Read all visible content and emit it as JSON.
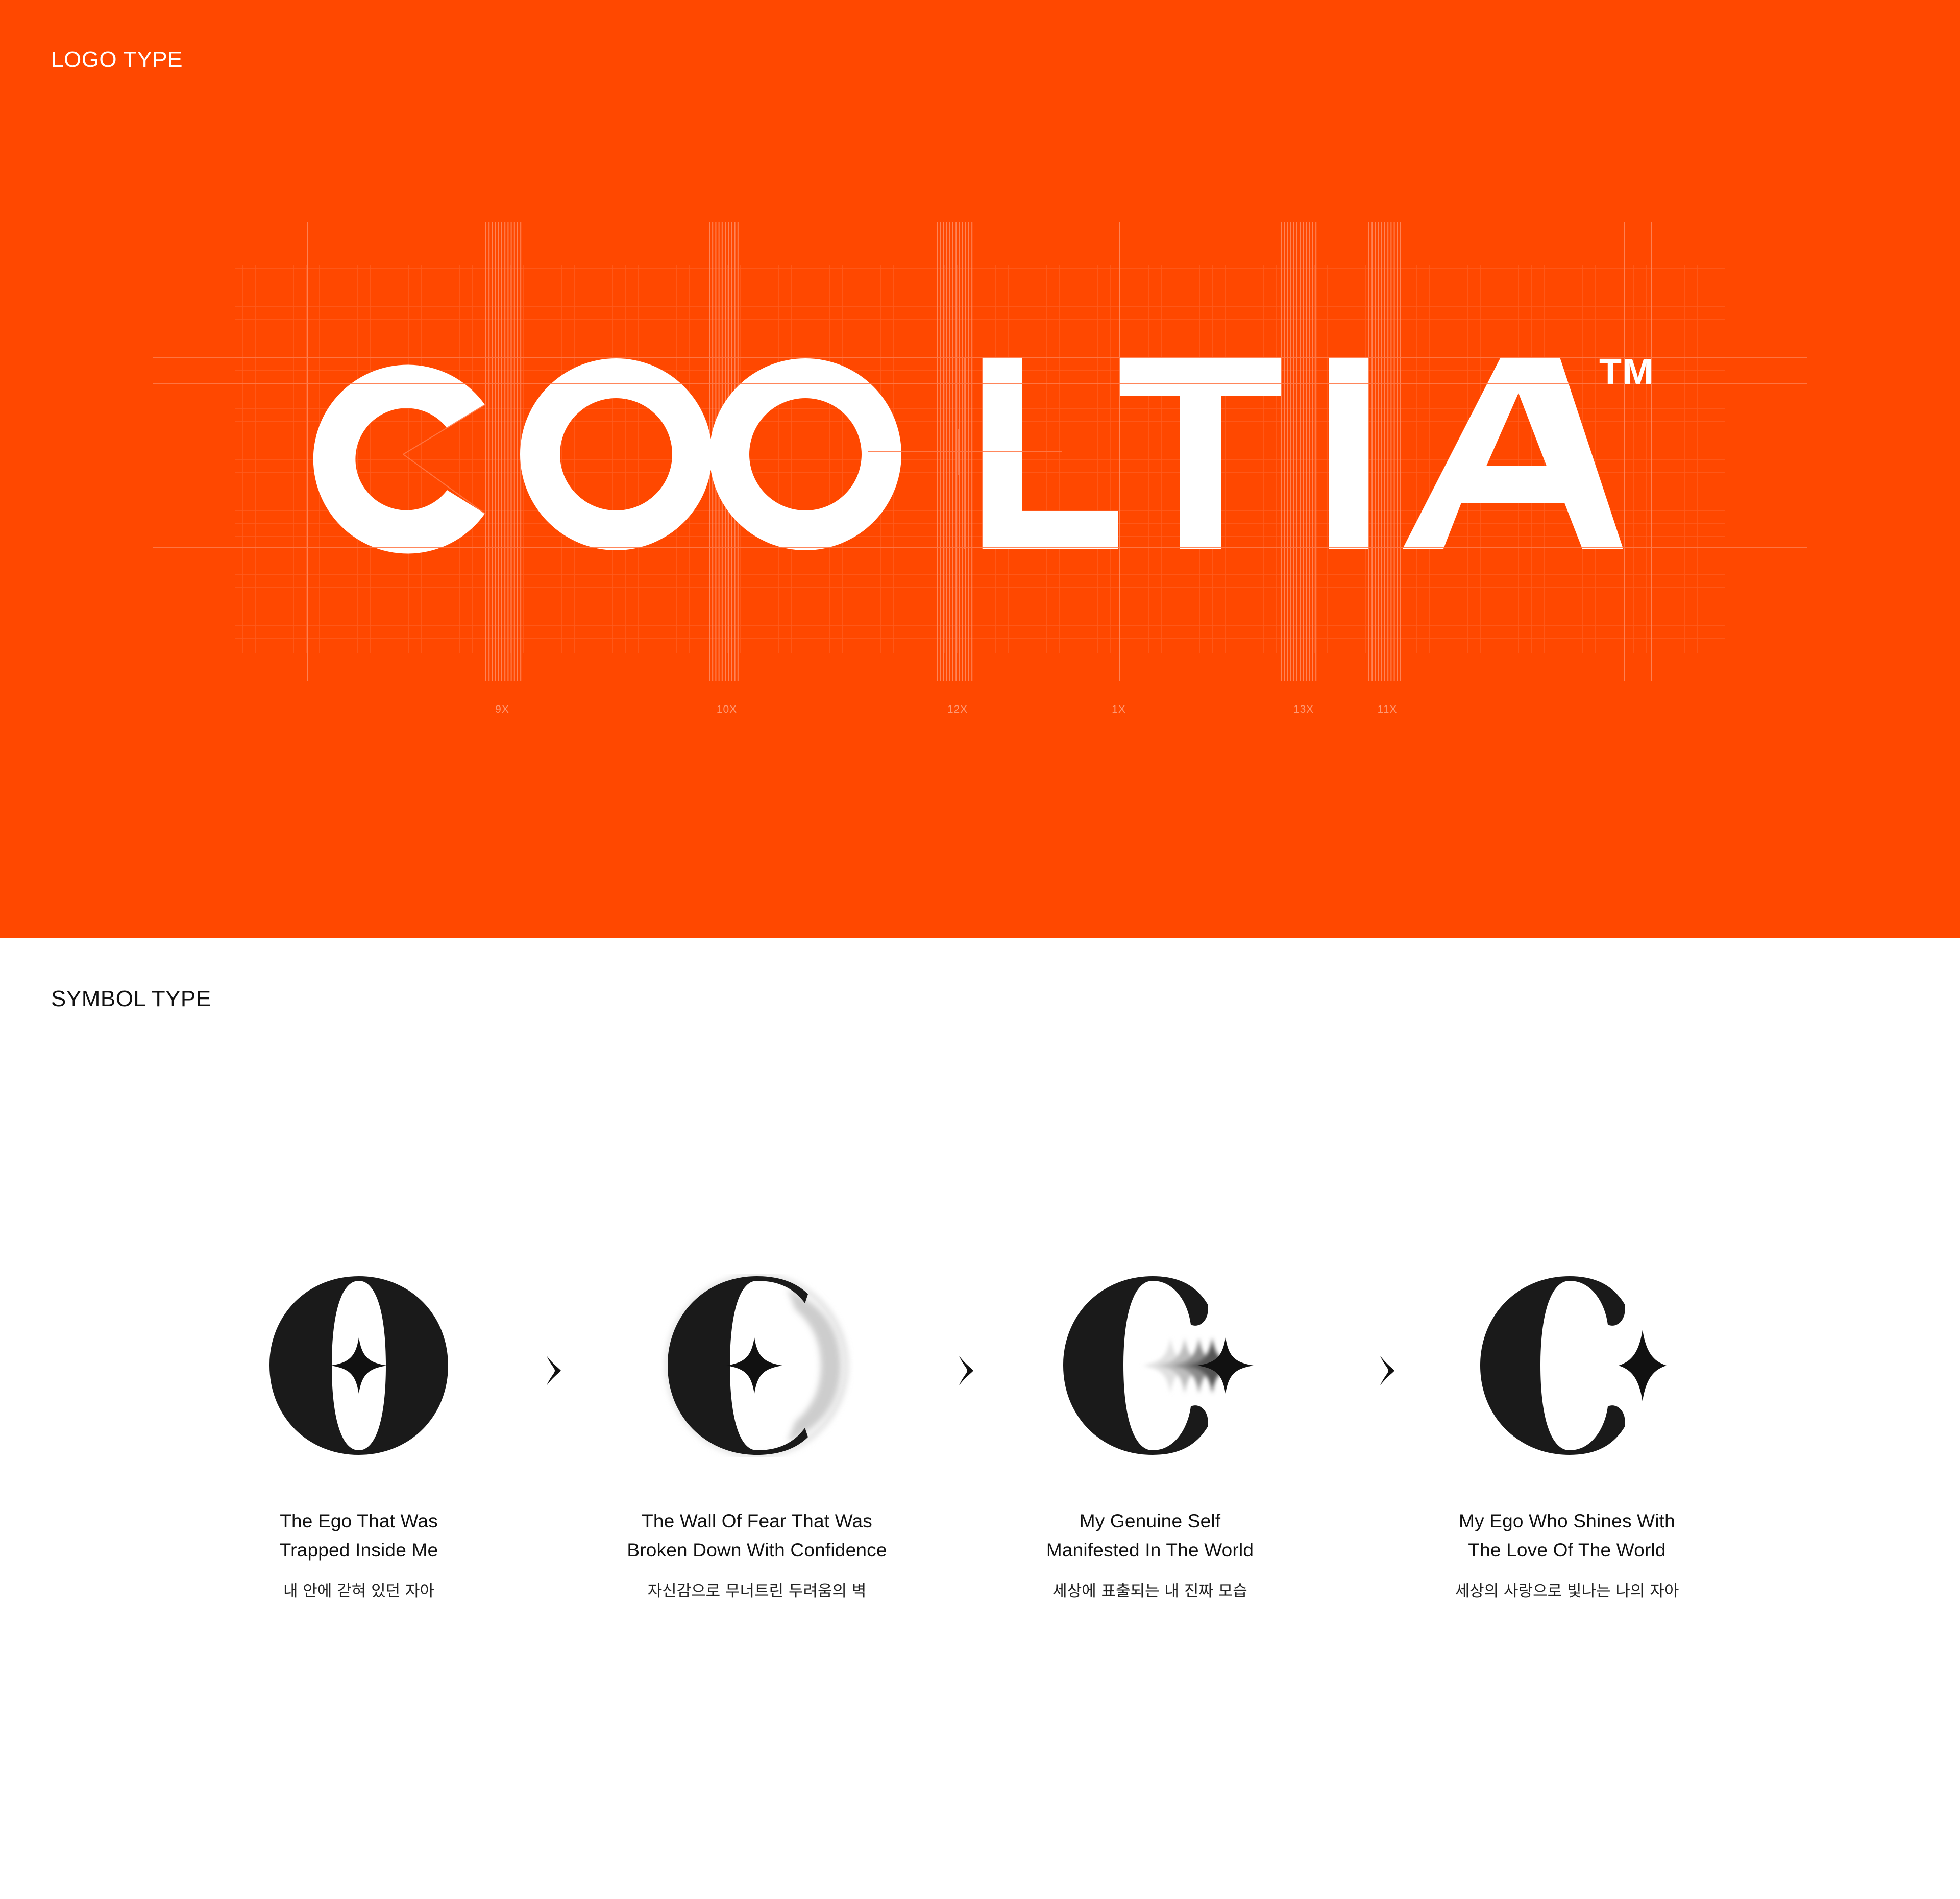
{
  "colors": {
    "brand": "#FF4800",
    "white": "#FFFFFF",
    "ink": "#1A1A1A",
    "grid_line": "#FF7A4A"
  },
  "logo_section": {
    "title": "LOGO TYPE",
    "wordmark": "COOLTIA",
    "trademark": "TM",
    "grid_labels": [
      "9X",
      "10X",
      "12X",
      "1X",
      "13X",
      "11X"
    ]
  },
  "symbol_section": {
    "title": "SYMBOL TYPE",
    "arrow_icon": "chevron-right-icon",
    "steps": [
      {
        "icon": "letter-o-with-star-icon",
        "caption_line1": "The Ego That Was",
        "caption_line2": "Trapped Inside Me",
        "korean": "내 안에 갇혀 있던 자아"
      },
      {
        "icon": "letter-o-breaking-with-star-icon",
        "caption_line1": "The Wall Of Fear That Was",
        "caption_line2": "Broken Down With Confidence",
        "korean": "자신감으로 무너트린 두려움의 벽"
      },
      {
        "icon": "letter-c-with-moving-star-icon",
        "caption_line1": "My Genuine Self",
        "caption_line2": "Manifested In The World",
        "korean": "세상에 표출되는 내 진짜 모습"
      },
      {
        "icon": "letter-c-with-star-icon",
        "caption_line1": "My Ego Who Shines With",
        "caption_line2": "The Love Of The World",
        "korean": "세상의 사랑으로 빛나는 나의 자아"
      }
    ]
  }
}
